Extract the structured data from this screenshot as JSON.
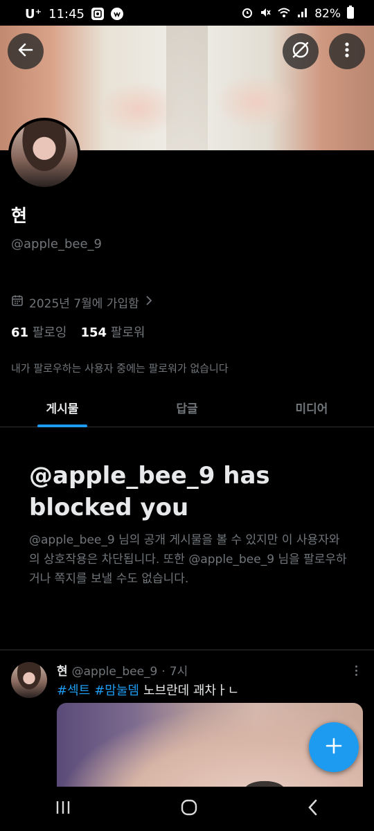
{
  "status_bar": {
    "carrier": "U⁺",
    "time": "11:45",
    "battery": "82%",
    "icons": [
      "gallery-app-icon",
      "messaging-app-icon",
      "alarm-icon",
      "mute-icon",
      "wifi-icon",
      "signal-icon",
      "battery-icon"
    ]
  },
  "header_buttons": {
    "back": "arrow-left-icon",
    "grok": "slash-circle-icon",
    "more": "vertical-dots-icon"
  },
  "profile": {
    "name": "현",
    "handle": "@apple_bee_9",
    "joined": "2025년 7월에 가입함",
    "following_count": "61",
    "following_label": "팔로잉",
    "followers_count": "154",
    "followers_label": "팔로워",
    "followers_you_know": "내가 팔로우하는 사용자 중에는 팔로워가 없습니다"
  },
  "tabs": [
    {
      "label": "게시물",
      "active": true
    },
    {
      "label": "답글",
      "active": false
    },
    {
      "label": "미디어",
      "active": false
    }
  ],
  "blocked": {
    "title": "@apple_bee_9 has blocked you",
    "description": "@apple_bee_9 님의 공개 게시물을 볼 수 있지만 이 사용자와의 상호작용은 차단됩니다. 또한 @apple_bee_9 님을 팔로우하거나 쪽지를 보낼 수도 없습니다."
  },
  "post": {
    "name": "현",
    "handle": "@apple_bee_9",
    "separator": "·",
    "time": "7시",
    "hashtags": [
      "#섹트",
      "#맘눌뎀"
    ],
    "text": "노브란데 괘차ㅏㄴ"
  },
  "fab": {
    "icon": "plus-icon"
  },
  "nav": {
    "recents": "recents-icon",
    "home": "home-icon",
    "back": "back-chevron-icon"
  },
  "colors": {
    "accent": "#1d9bf0",
    "background": "#000000",
    "muted": "#71767b",
    "text": "#e7e9ea"
  }
}
